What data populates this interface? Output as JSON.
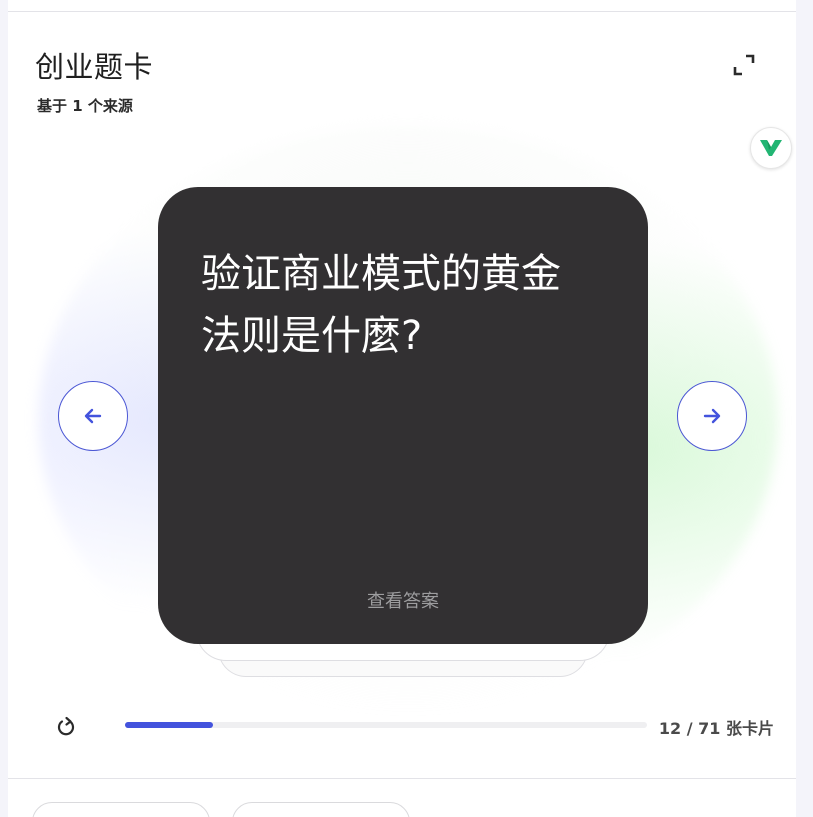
{
  "header": {
    "title": "创业题卡",
    "subtitle": "基于 1 个来源"
  },
  "icons": {
    "fullscreen": "fullscreen-icon",
    "source": "source-logo-icon",
    "prev": "arrow-left-icon",
    "next": "arrow-right-icon",
    "restart": "restart-icon"
  },
  "card": {
    "question": "验证商业模式的黄金法则是什麼?",
    "hint": "查看答案"
  },
  "progress": {
    "current": 12,
    "total": 71,
    "label": "12 / 71 张卡片"
  },
  "colors": {
    "accent": "#4353dd",
    "card_background": "#323032",
    "source_logo": "#22b573"
  }
}
